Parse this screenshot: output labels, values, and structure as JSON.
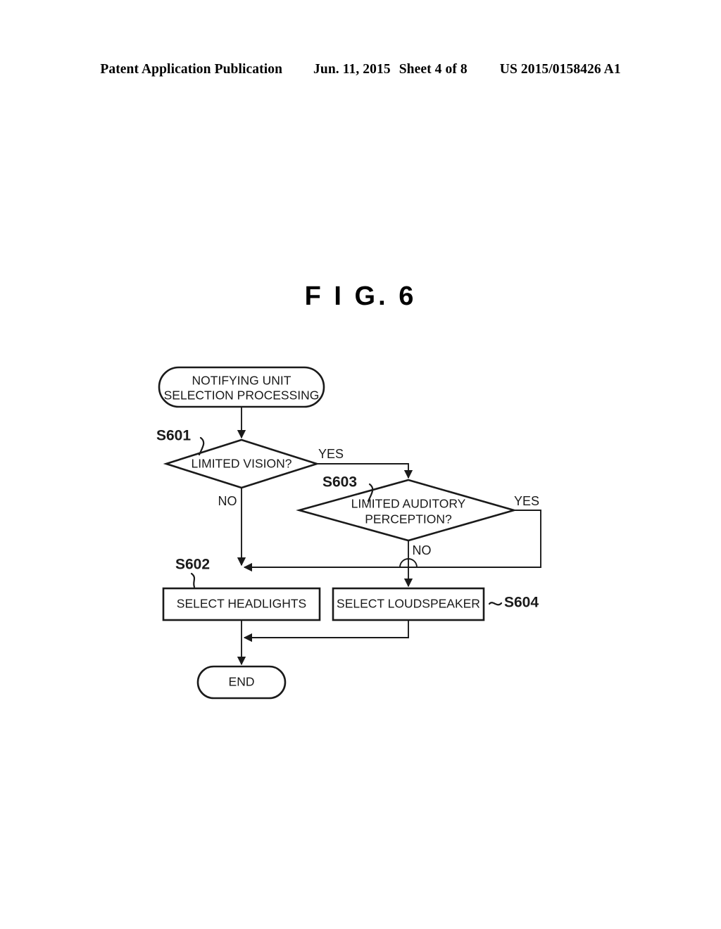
{
  "header": {
    "publication": "Patent Application Publication",
    "date": "Jun. 11, 2015",
    "sheet": "Sheet 4 of 8",
    "doc_number": "US 2015/0158426 A1"
  },
  "figure": {
    "title": "F I G.  6"
  },
  "flowchart": {
    "start": {
      "line1": "NOTIFYING UNIT",
      "line2": "SELECTION PROCESSING"
    },
    "decision1": {
      "step": "S601",
      "text": "LIMITED VISION?",
      "yes": "YES",
      "no": "NO"
    },
    "decision2": {
      "step": "S603",
      "line1": "LIMITED AUDITORY",
      "line2": "PERCEPTION?",
      "yes": "YES",
      "no": "NO"
    },
    "process1": {
      "step": "S602",
      "text": "SELECT HEADLIGHTS"
    },
    "process2": {
      "step": "S604",
      "text": "SELECT LOUDSPEAKER"
    },
    "end": {
      "text": "END"
    }
  }
}
